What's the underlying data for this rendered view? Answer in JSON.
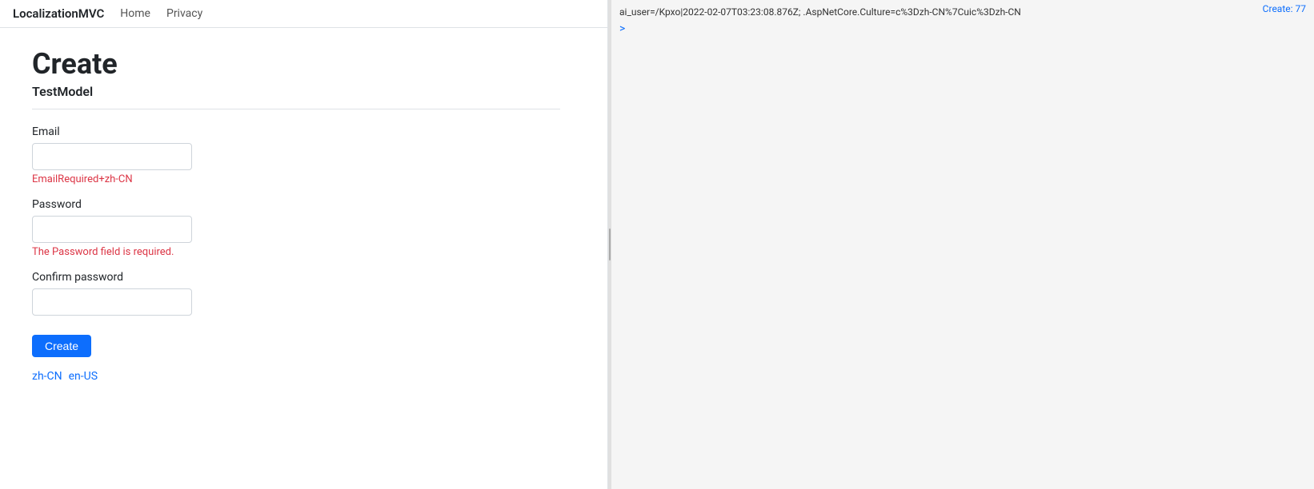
{
  "navbar": {
    "brand": "LocalizationMVC",
    "links": [
      {
        "label": "Home",
        "href": "#"
      },
      {
        "label": "Privacy",
        "href": "#"
      }
    ]
  },
  "form": {
    "page_title": "Create",
    "page_subtitle": "TestModel",
    "email_label": "Email",
    "email_value": "",
    "email_placeholder": "",
    "email_error": "EmailRequired+zh-CN",
    "password_label": "Password",
    "password_value": "",
    "password_placeholder": "",
    "password_error": "The Password field is required.",
    "confirm_password_label": "Confirm password",
    "confirm_password_value": "",
    "confirm_password_placeholder": "",
    "submit_label": "Create"
  },
  "locale_links": [
    {
      "label": "zh-CN",
      "href": "#"
    },
    {
      "label": "en-US",
      "href": "#"
    }
  ],
  "right_panel": {
    "cookie_text": "ai_user=/Kpxo|2022-02-07T03:23:08.876Z;  .AspNetCore.Culture=c%3Dzh-CN%7Cuic%3Dzh-CN",
    "link_text": "Create: 77",
    "arrow": ">"
  }
}
